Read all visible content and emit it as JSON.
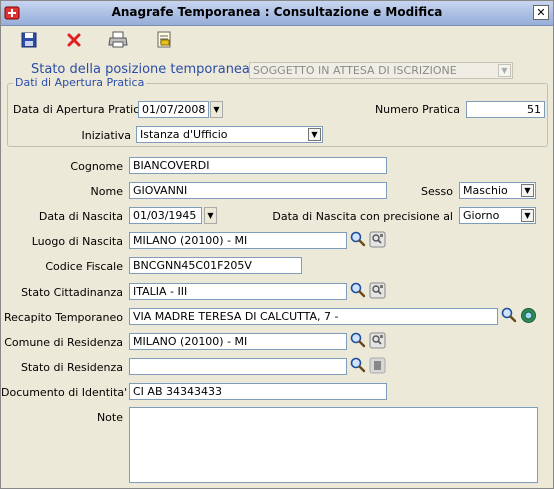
{
  "window": {
    "title": "Anagrafe Temporanea : Consultazione e Modifica",
    "close_glyph": "✕"
  },
  "toolbar": {
    "items": [
      "save-icon",
      "delete-icon",
      "print-icon",
      "report-icon"
    ]
  },
  "stato": {
    "label": "Stato della posizione temporanea",
    "value": "SOGGETTO IN ATTESA DI ISCRIZIONE"
  },
  "apertura": {
    "legend": "Dati di Apertura Pratica",
    "data_label": "Data di Apertura Pratica",
    "data_value": "01/07/2008",
    "numero_label": "Numero Pratica",
    "numero_value": "51",
    "iniziativa_label": "Iniziativa",
    "iniziativa_value": "Istanza d'Ufficio"
  },
  "form": {
    "cognome_label": "Cognome",
    "cognome_value": "BIANCOVERDI",
    "nome_label": "Nome",
    "nome_value": "GIOVANNI",
    "sesso_label": "Sesso",
    "sesso_value": "Maschio",
    "nascita_label": "Data di Nascita",
    "nascita_value": "01/03/1945",
    "precisione_label": "Data di Nascita con precisione al",
    "precisione_value": "Giorno",
    "luogo_label": "Luogo di Nascita",
    "luogo_value": "MILANO (20100) - MI",
    "cf_label": "Codice Fiscale",
    "cf_value": "BNCGNN45C01F205V",
    "cittadinanza_label": "Stato Cittadinanza",
    "cittadinanza_value": "ITALIA - III",
    "recapito_label": "Recapito Temporaneo",
    "recapito_value": "VIA MADRE TERESA DI CALCUTTA, 7 -",
    "comune_label": "Comune di Residenza",
    "comune_value": "MILANO (20100) - MI",
    "stato_res_label": "Stato di Residenza",
    "stato_res_value": "",
    "documento_label": "Documento di Identita'",
    "documento_value": "CI AB 34343433",
    "note_label": "Note",
    "note_value": ""
  },
  "colors": {
    "accent": "#2b4da8",
    "window_bg": "#ece9d8",
    "title_bg": "#a9bde2"
  }
}
